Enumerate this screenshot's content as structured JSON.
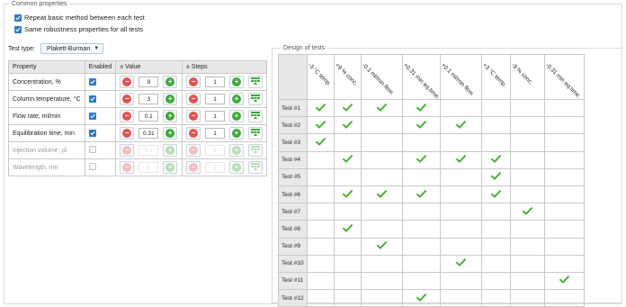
{
  "common": {
    "legend": "Common properties",
    "repeat_label": "Repeat basic method between each test",
    "repeat_checked": true,
    "same_label": "Same robustness properties for all tests",
    "same_checked": true
  },
  "test_type": {
    "label": "Test type:",
    "value": "Plakett-Burman"
  },
  "props_table": {
    "headers": {
      "property": "Property",
      "enabled": "Enabled",
      "value": "± Value",
      "steps": "± Steps"
    },
    "rows": [
      {
        "property": "Concentration, %",
        "enabled": true,
        "value": "9",
        "steps": "1"
      },
      {
        "property": "Column temperature, °C",
        "enabled": true,
        "value": "3",
        "steps": "1"
      },
      {
        "property": "Flow rate, ml/min",
        "enabled": true,
        "value": "0.1",
        "steps": "1"
      },
      {
        "property": "Equilibration time, min",
        "enabled": true,
        "value": "0.31",
        "steps": "1"
      },
      {
        "property": "Injection volume, µl",
        "enabled": false,
        "value": "0.1",
        "steps": "1"
      },
      {
        "property": "Wavelength, nm",
        "enabled": false,
        "value": "5",
        "steps": "1"
      }
    ]
  },
  "design": {
    "legend": "Design of tests",
    "columns": [
      "-3 °C temp.",
      "+9 % conc.",
      "-0.1 ml/min flow.",
      "+0.31 min eq.time.",
      "+0.1 ml/min flow.",
      "+3 °C temp.",
      "-9 % conc.",
      "-0.31 min eq.time."
    ],
    "rows": [
      {
        "label": "Test #1",
        "checks": [
          1,
          1,
          1,
          1,
          0,
          0,
          0,
          0
        ]
      },
      {
        "label": "Test #2",
        "checks": [
          1,
          1,
          0,
          1,
          1,
          0,
          0,
          0
        ]
      },
      {
        "label": "Test #3",
        "checks": [
          1,
          0,
          0,
          0,
          0,
          0,
          0,
          0
        ]
      },
      {
        "label": "Test #4",
        "checks": [
          0,
          1,
          0,
          1,
          1,
          1,
          0,
          0
        ]
      },
      {
        "label": "Test #5",
        "checks": [
          0,
          0,
          0,
          0,
          0,
          1,
          0,
          0
        ]
      },
      {
        "label": "Test #6",
        "checks": [
          0,
          1,
          1,
          1,
          0,
          1,
          0,
          0
        ]
      },
      {
        "label": "Test #7",
        "checks": [
          0,
          0,
          0,
          0,
          0,
          0,
          1,
          0
        ]
      },
      {
        "label": "Test #8",
        "checks": [
          0,
          1,
          0,
          0,
          0,
          0,
          0,
          0
        ]
      },
      {
        "label": "Test #9",
        "checks": [
          0,
          0,
          1,
          0,
          0,
          0,
          0,
          0
        ]
      },
      {
        "label": "Test #10",
        "checks": [
          0,
          0,
          0,
          0,
          1,
          0,
          0,
          0
        ]
      },
      {
        "label": "Test #11",
        "checks": [
          0,
          0,
          0,
          0,
          0,
          0,
          0,
          1
        ]
      },
      {
        "label": "Test #12",
        "checks": [
          0,
          0,
          0,
          1,
          0,
          0,
          0,
          0
        ]
      }
    ]
  },
  "colors": {
    "check_green": "#4caf3d",
    "checkbox_blue": "#2e7cc4",
    "minus_red": "#e05454",
    "plus_green": "#3fa83c"
  }
}
